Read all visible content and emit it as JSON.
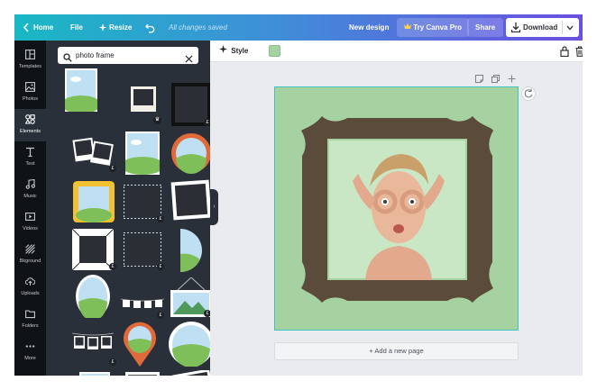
{
  "topbar": {
    "home_label": "Home",
    "file_label": "File",
    "resize_label": "Resize",
    "saved_status": "All changes saved",
    "new_design_label": "New design",
    "try_pro_label": "Try Canva Pro",
    "share_label": "Share",
    "download_label": "Download",
    "gradient_colors": [
      "#19b8c4",
      "#6a4fe0"
    ]
  },
  "rail": {
    "items": [
      {
        "label": "Templates",
        "icon": "templates-icon"
      },
      {
        "label": "Photos",
        "icon": "photos-icon"
      },
      {
        "label": "Elements",
        "icon": "elements-icon",
        "active": true
      },
      {
        "label": "Text",
        "icon": "text-icon"
      },
      {
        "label": "Music",
        "icon": "music-icon"
      },
      {
        "label": "Videos",
        "icon": "videos-icon"
      },
      {
        "label": "Bkground",
        "icon": "background-icon"
      },
      {
        "label": "Uploads",
        "icon": "uploads-icon"
      },
      {
        "label": "Folders",
        "icon": "folders-icon"
      },
      {
        "label": "More",
        "icon": "more-icon"
      }
    ]
  },
  "panel": {
    "search_value": "photo frame",
    "premium_badge": "£"
  },
  "editor": {
    "style_label": "Style",
    "canvas_color": "#a5d2a0",
    "frame_color": "#5b4b3a",
    "add_page_label": "+ Add a new page"
  }
}
